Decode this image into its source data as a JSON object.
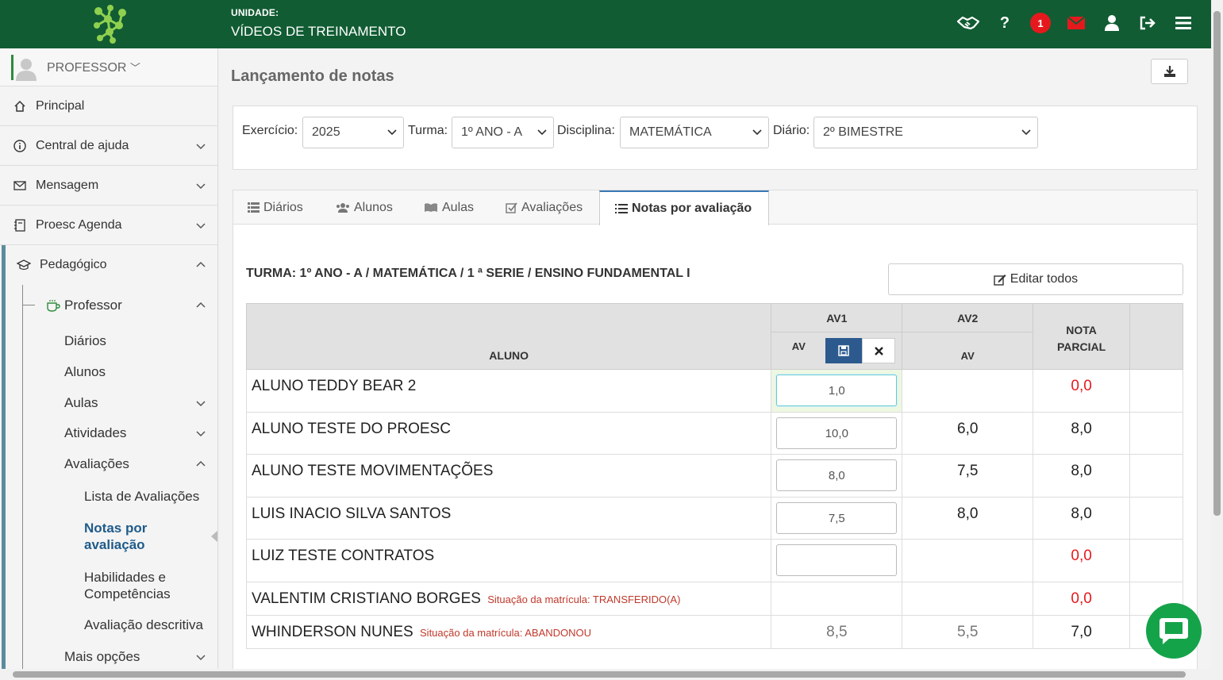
{
  "header": {
    "unit_caption": "UNIDADE:",
    "unit_name": "VÍDEOS DE TREINAMENTO",
    "notification_count": "1"
  },
  "sidebar": {
    "user_label": "PROFESSOR",
    "menu": [
      {
        "label": "Principal",
        "icon": "home-icon"
      },
      {
        "label": "Central de ajuda",
        "icon": "info-icon"
      },
      {
        "label": "Mensagem",
        "icon": "envelope-icon"
      },
      {
        "label": "Proesc Agenda",
        "icon": "agenda-icon"
      }
    ],
    "pedagogico": "Pedagógico",
    "professor": "Professor",
    "prof_items": [
      "Diários",
      "Alunos",
      "Aulas",
      "Atividades",
      "Avaliações"
    ],
    "aval_items": [
      "Lista de Avaliações",
      "Notas por avaliação",
      "Habilidades e Competências",
      "Avaliação descritiva"
    ],
    "mais": "Mais opções"
  },
  "page": {
    "title": "Lançamento de notas"
  },
  "filters": {
    "exercicio_label": "Exercício:",
    "exercicio_value": "2025",
    "turma_label": "Turma:",
    "turma_value": "1º ANO - A",
    "disciplina_label": "Disciplina:",
    "disciplina_value": "MATEMÁTICA",
    "diario_label": "Diário:",
    "diario_value": "2º BIMESTRE"
  },
  "tabs": [
    "Diários",
    "Alunos",
    "Aulas",
    "Avaliações",
    "Notas por avaliação"
  ],
  "content": {
    "turma_line": "TURMA: 1º ANO - A / MATEMÁTICA / 1 ª SERIE / ENSINO FUNDAMENTAL I",
    "edit_all": "Editar todos",
    "headers": {
      "aluno": "ALUNO",
      "av1": "AV1",
      "av2": "AV2",
      "av": "AV",
      "nota1": "NOTA",
      "nota2": "PARCIAL"
    },
    "rows": [
      {
        "name": "ALUNO TEDDY BEAR 2",
        "situacao": "",
        "av1": "1,0",
        "av2": "",
        "nota": "0,0"
      },
      {
        "name": "ALUNO TESTE DO PROESC",
        "situacao": "",
        "av1": "10,0",
        "av2": "6,0",
        "nota": "8,0"
      },
      {
        "name": "ALUNO TESTE MOVIMENTAÇÕES",
        "situacao": "",
        "av1": "8,0",
        "av2": "7,5",
        "nota": "8,0"
      },
      {
        "name": "LUIS INACIO SILVA SANTOS",
        "situacao": "",
        "av1": "7,5",
        "av2": "8,0",
        "nota": "8,0"
      },
      {
        "name": "LUIZ TESTE CONTRATOS",
        "situacao": "",
        "av1": "",
        "av2": "",
        "nota": "0,0"
      },
      {
        "name": "VALENTIM CRISTIANO BORGES",
        "situacao": "Situação da matrícula: TRANSFERIDO(A)",
        "av1": "",
        "av2": "",
        "nota": "0,0"
      },
      {
        "name": "WHINDERSON NUNES",
        "situacao": "Situação da matrícula: ABANDONOU",
        "av1": "8,5",
        "av2": "5,5",
        "nota": "7,0"
      }
    ]
  },
  "colors": {
    "topbar": "#115c33",
    "accent_blue": "#2d5a8e",
    "danger": "#e5191d",
    "chat": "#15a34a"
  }
}
